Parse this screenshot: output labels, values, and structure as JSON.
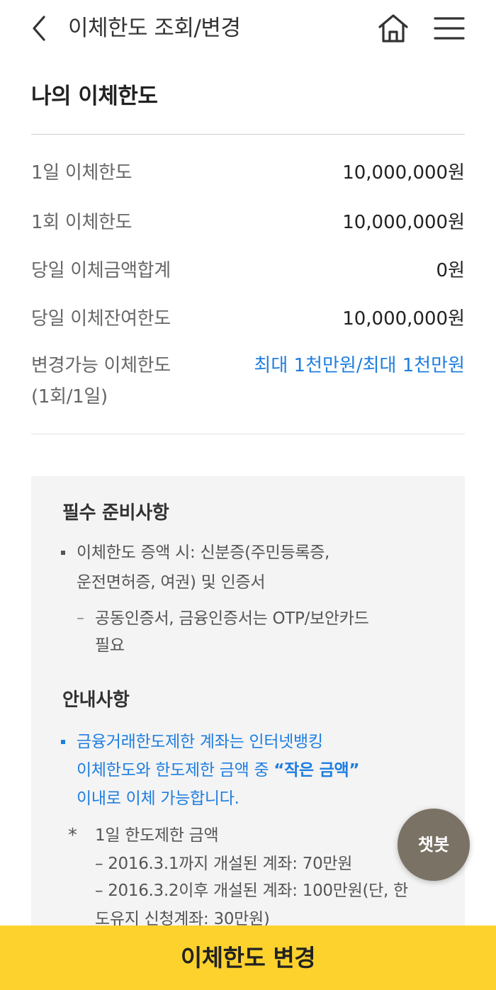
{
  "header": {
    "title": "이체한도 조회/변경",
    "back_icon": "chevron-left-icon",
    "home_icon": "home-icon",
    "menu_icon": "hamburger-menu-icon"
  },
  "section": {
    "title": "나의 이체한도"
  },
  "limits": [
    {
      "label": "1일 이체한도",
      "value": "10,000,000원"
    },
    {
      "label": "1회 이체한도",
      "value": "10,000,000원"
    },
    {
      "label": "당일 이체금액합계",
      "value": "0원"
    },
    {
      "label": "당일 이체잔여한도",
      "value": "10,000,000원"
    },
    {
      "label": "변경가능 이체한도",
      "label_line2": "(1회/1일)",
      "value": "최대 1천만원/최대 1천만원"
    }
  ],
  "prep": {
    "title": "필수 준비사항",
    "item_line1": "이체한도 증액 시: 신분증(주민등록증,",
    "item_line2": "운전면허증, 여권) 및 인증서",
    "sub_dash": "–",
    "sub_line1": "공동인증서, 금융인증서는 OTP/보안카드",
    "sub_line2": "필요"
  },
  "notice": {
    "title": "안내사항",
    "item_line1": "금융거래한도제한 계좌는 인터넷뱅킹",
    "item_line2_prefix": "이체한도와 한도제한 금액 중 ",
    "item_line2_emph": "“작은 금액”",
    "item_line3": "이내로 이체 가능합니다.",
    "star": "*",
    "star_title": "1일 한도제한 금액",
    "detail1": "– 2016.3.1까지 개설된 계좌: 70만원",
    "detail2": "– 2016.3.2이후 개설된 계좌: 100만원(단, 한",
    "detail3": "도유지 신청계좌: 30만원)"
  },
  "chatbot": {
    "label": "챗봇"
  },
  "bottom_button": {
    "label": "이체한도 변경"
  },
  "colors": {
    "accent_blue": "#1e7ee0",
    "button_yellow": "#fdd22d",
    "chatbot_bg": "#7b7266"
  }
}
